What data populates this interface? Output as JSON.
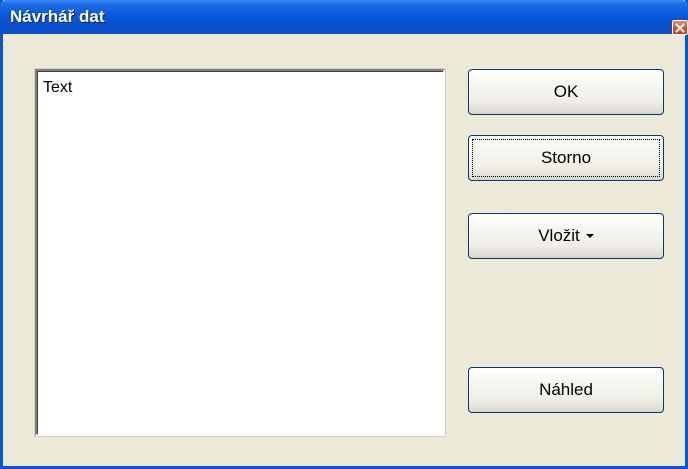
{
  "window": {
    "title": "Návrhář dat"
  },
  "editor": {
    "value": "Text"
  },
  "buttons": {
    "ok": "OK",
    "cancel": "Storno",
    "insert": "Vložit",
    "preview": "Náhled"
  },
  "icons": {
    "close": "close-icon",
    "dropdown": "chevron-down-icon"
  },
  "colors": {
    "titlebar": "#0a5bd9",
    "window_bg": "#ece9d8",
    "close_button": "#d9542b",
    "button_border": "#003c74"
  }
}
